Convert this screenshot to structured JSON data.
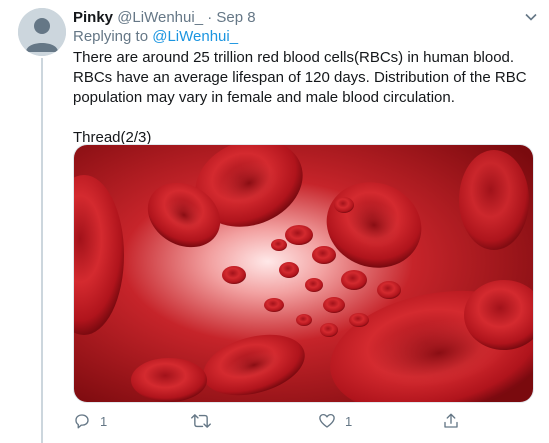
{
  "tweet": {
    "author_name": "Pinky",
    "author_handle": "@LiWenhui_",
    "separator": "·",
    "date": "Sep 8",
    "replying_to_prefix": "Replying to",
    "replying_to_handle": "@LiWenhui_",
    "text_line_1": "There are around 25 trillion red blood cells(RBCs) in human blood.  RBCs have an average lifespan of 120 days.  Distribution of the RBC population may vary in female and male blood circulation.",
    "text_line_2": "Thread(2/3)",
    "media_description_icon": "red-blood-cells-image",
    "actions": {
      "reply_count": "1",
      "retweet_count": "",
      "like_count": "1",
      "share_count": ""
    }
  },
  "colors": {
    "link": "#1b95e0",
    "muted": "#657786",
    "text": "#14171a",
    "thread_line": "#ccd6dd"
  },
  "icons": [
    "avatar-placeholder-icon",
    "caret-down-icon",
    "reply-icon",
    "retweet-icon",
    "like-icon",
    "share-icon"
  ]
}
